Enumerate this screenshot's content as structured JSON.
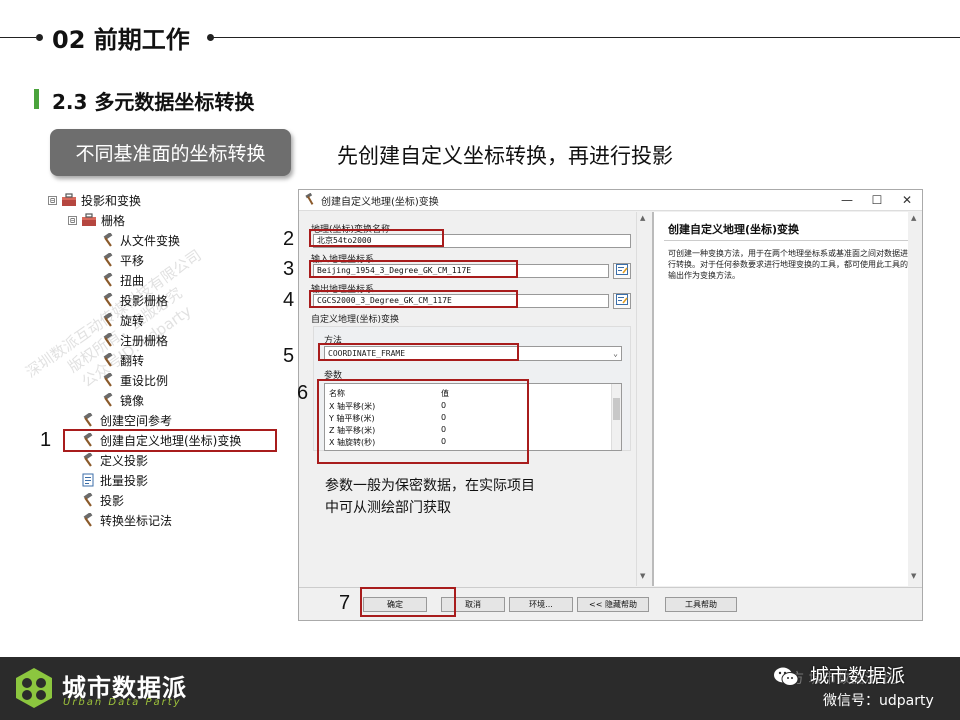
{
  "header": {
    "chapter_title": "02 前期工作",
    "section_title": "2.3 多元数据坐标转换",
    "badge": "不同基准面的坐标转换",
    "subtitle": "先创建自定义坐标转换，再进行投影"
  },
  "tree": [
    {
      "label": "投影和变换",
      "icon": "toolbox-icon",
      "expander": "⊟"
    },
    {
      "label": "栅格",
      "icon": "toolbox-icon",
      "expander": "⊟"
    },
    {
      "label": "从文件变换",
      "icon": "hammer-icon"
    },
    {
      "label": "平移",
      "icon": "hammer-icon"
    },
    {
      "label": "扭曲",
      "icon": "hammer-icon"
    },
    {
      "label": "投影栅格",
      "icon": "hammer-icon"
    },
    {
      "label": "旋转",
      "icon": "hammer-icon"
    },
    {
      "label": "注册栅格",
      "icon": "hammer-icon"
    },
    {
      "label": "翻转",
      "icon": "hammer-icon"
    },
    {
      "label": "重设比例",
      "icon": "hammer-icon"
    },
    {
      "label": "镜像",
      "icon": "hammer-icon"
    },
    {
      "label": "创建空间参考",
      "icon": "hammer-icon"
    },
    {
      "label": "创建自定义地理(坐标)变换",
      "icon": "hammer-icon"
    },
    {
      "label": "定义投影",
      "icon": "hammer-icon"
    },
    {
      "label": "批量投影",
      "icon": "script-icon"
    },
    {
      "label": "投影",
      "icon": "hammer-icon"
    },
    {
      "label": "转换坐标记法",
      "icon": "hammer-icon"
    }
  ],
  "step_numbers": [
    "1",
    "2",
    "3",
    "4",
    "5",
    "6",
    "7"
  ],
  "dialog": {
    "title": "创建自定义地理(坐标)变换",
    "window_buttons": [
      "—",
      "☐",
      "✕"
    ],
    "name_label": "地理(坐标)变换名称",
    "name_value": "北京54to2000",
    "input_cs_label": "输入地理坐标系",
    "input_cs_value": "Beijing_1954_3_Degree_GK_CM_117E",
    "output_cs_label": "输出地理坐标系",
    "output_cs_value": "CGCS2000_3_Degree_GK_CM_117E",
    "transform_label": "自定义地理(坐标)变换",
    "method_label": "方法",
    "method_value": "COORDINATE_FRAME",
    "params_label": "参数",
    "param_headers": [
      "名称",
      "值"
    ],
    "params": [
      {
        "name": "X 轴平移(米)",
        "value": "0"
      },
      {
        "name": "Y 轴平移(米)",
        "value": "0"
      },
      {
        "name": "Z 轴平移(米)",
        "value": "0"
      },
      {
        "name": "X 轴旋转(秒)",
        "value": "0"
      }
    ],
    "help_title": "创建自定义地理(坐标)变换",
    "help_text": "可创建一种变换方法，用于在两个地理坐标系或基准面之间对数据进行转换。对于任何参数要求进行地理变换的工具，都可使用此工具的输出作为变换方法。",
    "buttons": [
      "确定",
      "取消",
      "环境...",
      "<< 隐藏帮助",
      "工具帮助"
    ]
  },
  "note": "参数一般为保密数据，在实际项目中可从测绘部门获取",
  "watermark": [
    "深圳数派互动传媒科技有限公司",
    "版权所有，盗版必究",
    "公众号ID: udparty"
  ],
  "footer": {
    "logo_cn": "城市数据派",
    "logo_en": "Urban Data Party",
    "wechat_name": "城市数据派",
    "wechat_faint": "方  城市数据派 比",
    "wechat_id": "微信号：udparty"
  }
}
